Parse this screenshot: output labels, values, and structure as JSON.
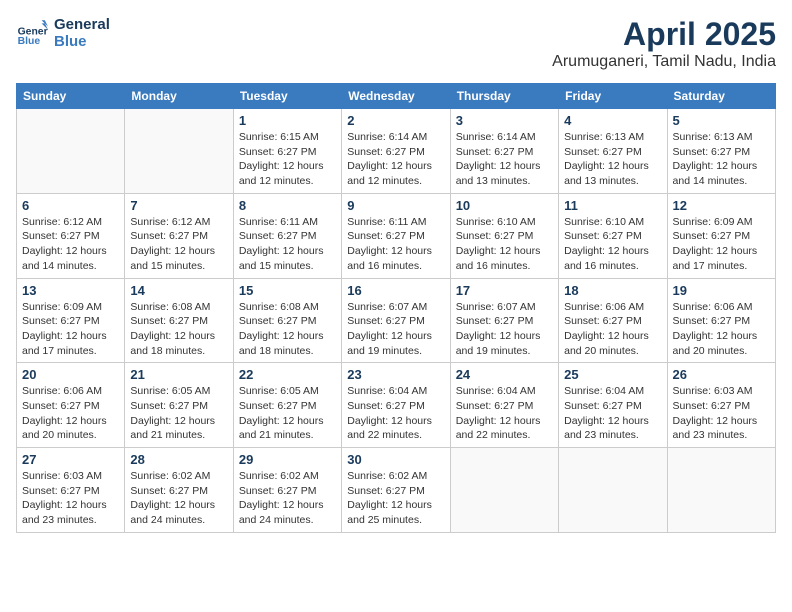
{
  "header": {
    "logo_general": "General",
    "logo_blue": "Blue",
    "title": "April 2025",
    "subtitle": "Arumuganeri, Tamil Nadu, India"
  },
  "weekdays": [
    "Sunday",
    "Monday",
    "Tuesday",
    "Wednesday",
    "Thursday",
    "Friday",
    "Saturday"
  ],
  "weeks": [
    [
      {
        "day": "",
        "info": ""
      },
      {
        "day": "",
        "info": ""
      },
      {
        "day": "1",
        "info": "Sunrise: 6:15 AM\nSunset: 6:27 PM\nDaylight: 12 hours\nand 12 minutes."
      },
      {
        "day": "2",
        "info": "Sunrise: 6:14 AM\nSunset: 6:27 PM\nDaylight: 12 hours\nand 12 minutes."
      },
      {
        "day": "3",
        "info": "Sunrise: 6:14 AM\nSunset: 6:27 PM\nDaylight: 12 hours\nand 13 minutes."
      },
      {
        "day": "4",
        "info": "Sunrise: 6:13 AM\nSunset: 6:27 PM\nDaylight: 12 hours\nand 13 minutes."
      },
      {
        "day": "5",
        "info": "Sunrise: 6:13 AM\nSunset: 6:27 PM\nDaylight: 12 hours\nand 14 minutes."
      }
    ],
    [
      {
        "day": "6",
        "info": "Sunrise: 6:12 AM\nSunset: 6:27 PM\nDaylight: 12 hours\nand 14 minutes."
      },
      {
        "day": "7",
        "info": "Sunrise: 6:12 AM\nSunset: 6:27 PM\nDaylight: 12 hours\nand 15 minutes."
      },
      {
        "day": "8",
        "info": "Sunrise: 6:11 AM\nSunset: 6:27 PM\nDaylight: 12 hours\nand 15 minutes."
      },
      {
        "day": "9",
        "info": "Sunrise: 6:11 AM\nSunset: 6:27 PM\nDaylight: 12 hours\nand 16 minutes."
      },
      {
        "day": "10",
        "info": "Sunrise: 6:10 AM\nSunset: 6:27 PM\nDaylight: 12 hours\nand 16 minutes."
      },
      {
        "day": "11",
        "info": "Sunrise: 6:10 AM\nSunset: 6:27 PM\nDaylight: 12 hours\nand 16 minutes."
      },
      {
        "day": "12",
        "info": "Sunrise: 6:09 AM\nSunset: 6:27 PM\nDaylight: 12 hours\nand 17 minutes."
      }
    ],
    [
      {
        "day": "13",
        "info": "Sunrise: 6:09 AM\nSunset: 6:27 PM\nDaylight: 12 hours\nand 17 minutes."
      },
      {
        "day": "14",
        "info": "Sunrise: 6:08 AM\nSunset: 6:27 PM\nDaylight: 12 hours\nand 18 minutes."
      },
      {
        "day": "15",
        "info": "Sunrise: 6:08 AM\nSunset: 6:27 PM\nDaylight: 12 hours\nand 18 minutes."
      },
      {
        "day": "16",
        "info": "Sunrise: 6:07 AM\nSunset: 6:27 PM\nDaylight: 12 hours\nand 19 minutes."
      },
      {
        "day": "17",
        "info": "Sunrise: 6:07 AM\nSunset: 6:27 PM\nDaylight: 12 hours\nand 19 minutes."
      },
      {
        "day": "18",
        "info": "Sunrise: 6:06 AM\nSunset: 6:27 PM\nDaylight: 12 hours\nand 20 minutes."
      },
      {
        "day": "19",
        "info": "Sunrise: 6:06 AM\nSunset: 6:27 PM\nDaylight: 12 hours\nand 20 minutes."
      }
    ],
    [
      {
        "day": "20",
        "info": "Sunrise: 6:06 AM\nSunset: 6:27 PM\nDaylight: 12 hours\nand 20 minutes."
      },
      {
        "day": "21",
        "info": "Sunrise: 6:05 AM\nSunset: 6:27 PM\nDaylight: 12 hours\nand 21 minutes."
      },
      {
        "day": "22",
        "info": "Sunrise: 6:05 AM\nSunset: 6:27 PM\nDaylight: 12 hours\nand 21 minutes."
      },
      {
        "day": "23",
        "info": "Sunrise: 6:04 AM\nSunset: 6:27 PM\nDaylight: 12 hours\nand 22 minutes."
      },
      {
        "day": "24",
        "info": "Sunrise: 6:04 AM\nSunset: 6:27 PM\nDaylight: 12 hours\nand 22 minutes."
      },
      {
        "day": "25",
        "info": "Sunrise: 6:04 AM\nSunset: 6:27 PM\nDaylight: 12 hours\nand 23 minutes."
      },
      {
        "day": "26",
        "info": "Sunrise: 6:03 AM\nSunset: 6:27 PM\nDaylight: 12 hours\nand 23 minutes."
      }
    ],
    [
      {
        "day": "27",
        "info": "Sunrise: 6:03 AM\nSunset: 6:27 PM\nDaylight: 12 hours\nand 23 minutes."
      },
      {
        "day": "28",
        "info": "Sunrise: 6:02 AM\nSunset: 6:27 PM\nDaylight: 12 hours\nand 24 minutes."
      },
      {
        "day": "29",
        "info": "Sunrise: 6:02 AM\nSunset: 6:27 PM\nDaylight: 12 hours\nand 24 minutes."
      },
      {
        "day": "30",
        "info": "Sunrise: 6:02 AM\nSunset: 6:27 PM\nDaylight: 12 hours\nand 25 minutes."
      },
      {
        "day": "",
        "info": ""
      },
      {
        "day": "",
        "info": ""
      },
      {
        "day": "",
        "info": ""
      }
    ]
  ]
}
